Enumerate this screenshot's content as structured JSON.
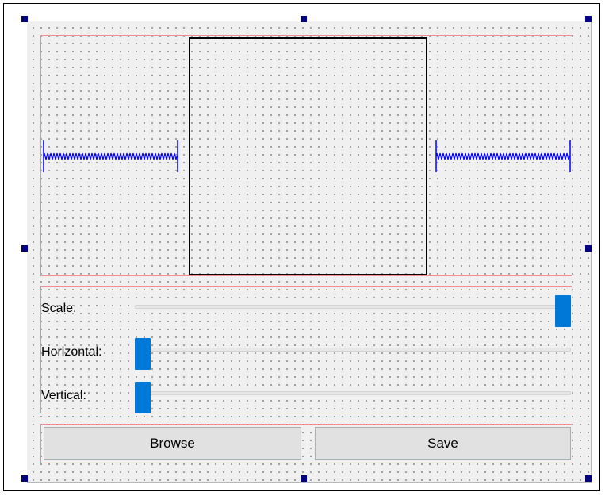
{
  "form": {
    "sliders": [
      {
        "label": "Scale:",
        "value": 1.0
      },
      {
        "label": "Horizontal:",
        "value": 0.0
      },
      {
        "label": "Vertical:",
        "value": 0.0
      }
    ],
    "buttons": {
      "browse_label": "Browse",
      "save_label": "Save"
    }
  },
  "colors": {
    "layout_outline": "#f28b8b",
    "spacer": "#0000ff",
    "slider_handle": "#0078d7",
    "selection_handle": "#000080"
  }
}
